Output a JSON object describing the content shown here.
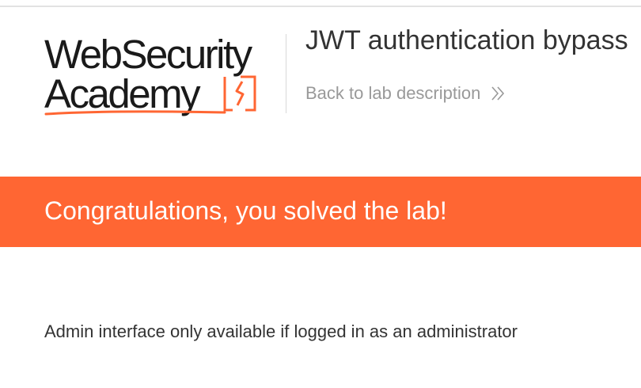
{
  "header": {
    "logo": {
      "line1": "WebSecurity",
      "line2": "Academy"
    },
    "lab_title": "JWT authentication bypass",
    "back_link": "Back to lab description",
    "back_icon": "double-chevron-right-icon"
  },
  "banner": {
    "message": "Congratulations, you solved the lab!",
    "color": "#ff6633"
  },
  "main": {
    "message": "Admin interface only available if logged in as an administrator"
  },
  "colors": {
    "accent": "#ff6633",
    "text": "#333333",
    "muted": "#999999"
  }
}
